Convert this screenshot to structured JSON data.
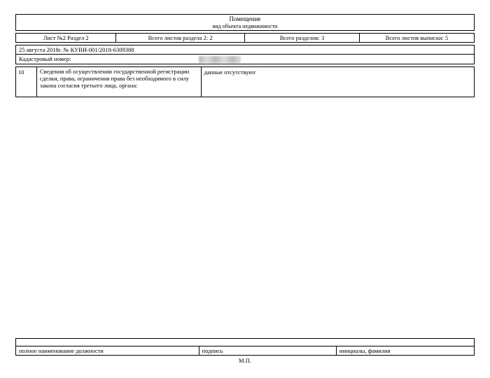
{
  "header": {
    "title": "Помещение",
    "subtitle": "вид объекта недвижимости"
  },
  "meta": {
    "sheet": "Лист №2  Раздел 2",
    "total_sheets_section": "Всего листов раздела 2: 2",
    "total_sections": "Всего разделов: 3",
    "total_sheets_extract": "Всего листов выписки: 5"
  },
  "reference": {
    "date_number": "25 августа 2018г. № КУВИ-001/2018-6309388",
    "cadastral_label": "Кадастровый номер:",
    "cadastral_value": ""
  },
  "rows": [
    {
      "num": "10",
      "desc": "Сведения об осуществлении государственной регистрации сделки, права, ограничения права без необходимого в силу закона согласия третьего лица, органа:",
      "value": "данные отсутствуют"
    }
  ],
  "signature": {
    "position": "полное наименование должности",
    "sign": "подпись",
    "initials": "инициалы, фамилия",
    "stamp": "М.П."
  }
}
